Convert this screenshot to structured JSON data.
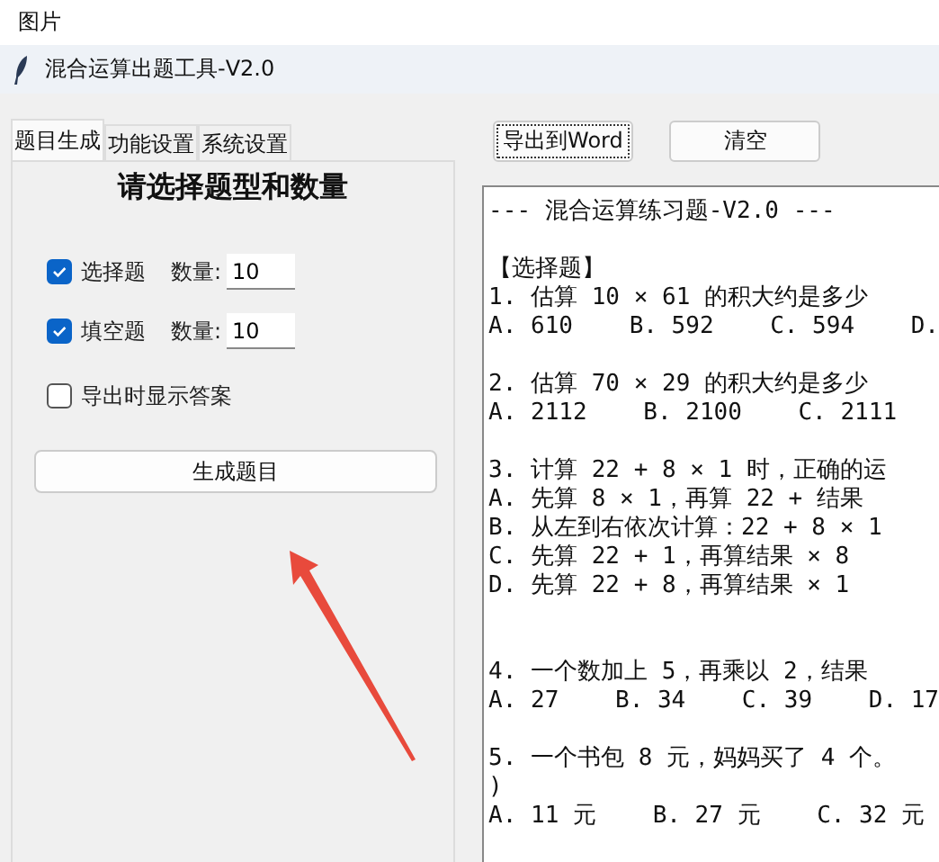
{
  "viewer": {
    "title": "图片"
  },
  "window": {
    "title": "混合运算出题工具-V2.0"
  },
  "tabs": [
    {
      "label": "题目生成",
      "selected": true
    },
    {
      "label": "功能设置",
      "selected": false
    },
    {
      "label": "系统设置",
      "selected": false
    }
  ],
  "panel": {
    "heading": "请选择题型和数量",
    "question_types": [
      {
        "label": "选择题",
        "checked": true,
        "count_label": "数量:",
        "count": "10"
      },
      {
        "label": "填空题",
        "checked": true,
        "count_label": "数量:",
        "count": "10"
      }
    ],
    "show_answers": {
      "label": "导出时显示答案",
      "checked": false
    },
    "generate_button": "生成题目"
  },
  "toolbar": [
    {
      "label": "导出到Word",
      "focused": true
    },
    {
      "label": "清空",
      "focused": false
    }
  ],
  "output_blocks": [
    {
      "lines": [
        "--- 混合运算练习题-V2.0 ---"
      ],
      "wide_gap": false
    },
    {
      "lines": [
        "【选择题】",
        "1. 估算 10 × 61 的积大约是多少",
        "A. 610    B. 592    C. 594    D."
      ],
      "wide_gap": false
    },
    {
      "lines": [
        "2. 估算 70 × 29 的积大约是多少",
        "A. 2112    B. 2100    C. 2111"
      ],
      "wide_gap": false
    },
    {
      "lines": [
        "3. 计算 22 + 8 × 1 时，正确的运",
        "A. 先算 8 × 1，再算 22 + 结果",
        "B. 从左到右依次计算：22 + 8 × 1",
        "C. 先算 22 + 1，再算结果 × 8",
        "D. 先算 22 + 8，再算结果 × 1"
      ],
      "wide_gap": false
    },
    {
      "lines": [
        "4. 一个数加上 5，再乘以 2，结果",
        "A. 27    B. 34    C. 39    D. 17"
      ],
      "wide_gap": true
    },
    {
      "lines": [
        "5. 一个书包 8 元，妈妈买了 4 个。",
        ")",
        "A. 11 元    B. 27 元    C. 32 元"
      ],
      "wide_gap": false
    }
  ]
}
